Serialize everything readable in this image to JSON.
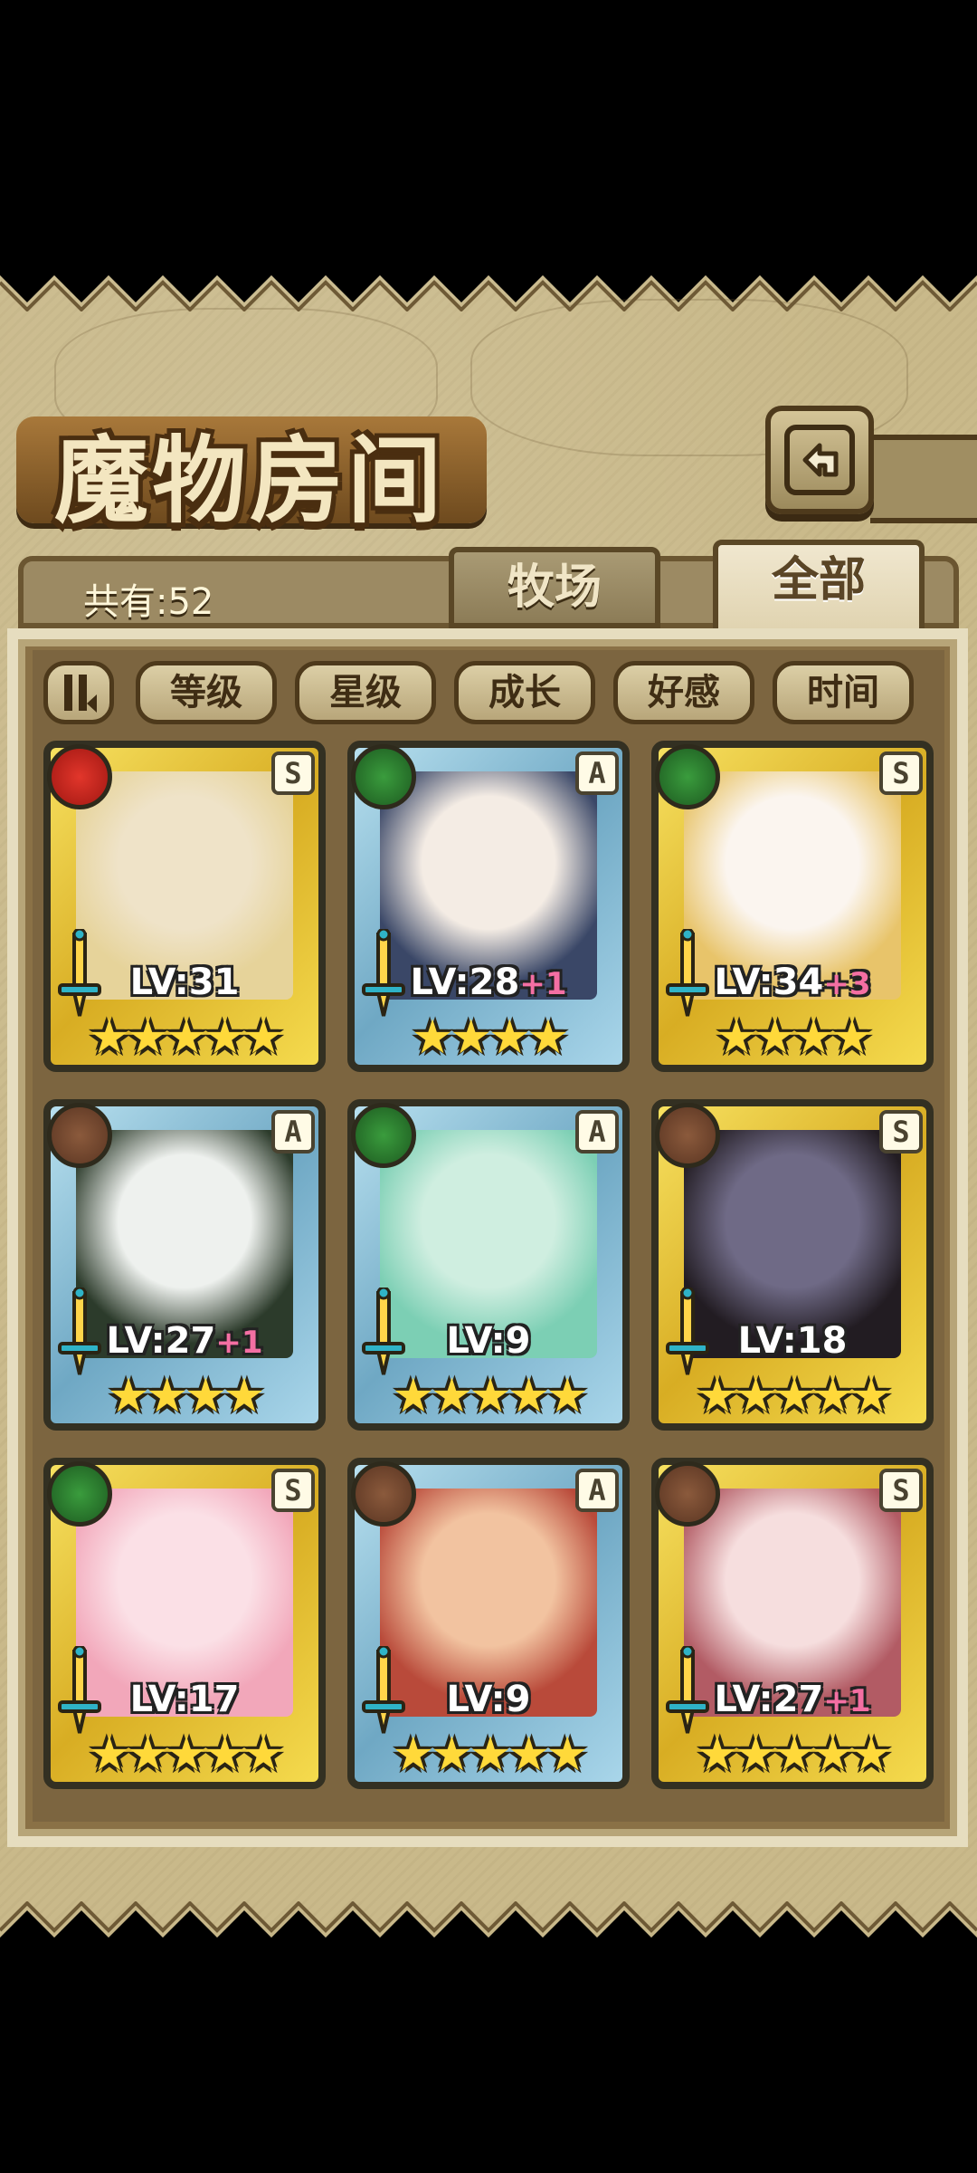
{
  "header": {
    "title": "魔物房间"
  },
  "summary": {
    "count_label": "共有:52"
  },
  "tabs": [
    {
      "label": "牧场",
      "active": false
    },
    {
      "label": "全部",
      "active": true
    }
  ],
  "filters": [
    {
      "label": "等级"
    },
    {
      "label": "星级"
    },
    {
      "label": "成长"
    },
    {
      "label": "好感"
    },
    {
      "label": "时间"
    }
  ],
  "monsters": [
    {
      "level": "LV:31",
      "plus": "",
      "rank": "S",
      "element": "fire",
      "frame": "gold",
      "stars": "★★★★★",
      "art_colors": [
        "#efe3c8",
        "#e6d39a"
      ]
    },
    {
      "level": "LV:28",
      "plus": "+1",
      "rank": "A",
      "element": "leaf",
      "frame": "blue",
      "stars": "★★★★",
      "art_colors": [
        "#f4ece4",
        "#3a4767"
      ]
    },
    {
      "level": "LV:34",
      "plus": "+3",
      "rank": "S",
      "element": "leaf",
      "frame": "gold",
      "stars": "★★★★",
      "art_colors": [
        "#fbf5ef",
        "#e8c46a"
      ]
    },
    {
      "level": "LV:27",
      "plus": "+1",
      "rank": "A",
      "element": "earth",
      "frame": "blue",
      "stars": "★★★★",
      "art_colors": [
        "#eef1ee",
        "#2c3b2b"
      ]
    },
    {
      "level": "LV:9",
      "plus": "",
      "rank": "A",
      "element": "leaf",
      "frame": "blue",
      "stars": "★★★★★",
      "art_colors": [
        "#cfeee0",
        "#7ccfb4"
      ]
    },
    {
      "level": "LV:18",
      "plus": "",
      "rank": "S",
      "element": "earth",
      "frame": "gold",
      "stars": "★★★★★",
      "art_colors": [
        "#6f6a86",
        "#221c22"
      ]
    },
    {
      "level": "LV:17",
      "plus": "",
      "rank": "S",
      "element": "leaf",
      "frame": "gold",
      "stars": "★★★★★",
      "art_colors": [
        "#fbe0e6",
        "#f2a7ba"
      ]
    },
    {
      "level": "LV:9",
      "plus": "",
      "rank": "A",
      "element": "earth",
      "frame": "blue",
      "stars": "★★★★★",
      "art_colors": [
        "#f2c3a0",
        "#b94a3a"
      ]
    },
    {
      "level": "LV:27",
      "plus": "+1",
      "rank": "S",
      "element": "earth",
      "frame": "gold",
      "stars": "★★★★★",
      "art_colors": [
        "#f6dede",
        "#b25b64"
      ]
    }
  ]
}
